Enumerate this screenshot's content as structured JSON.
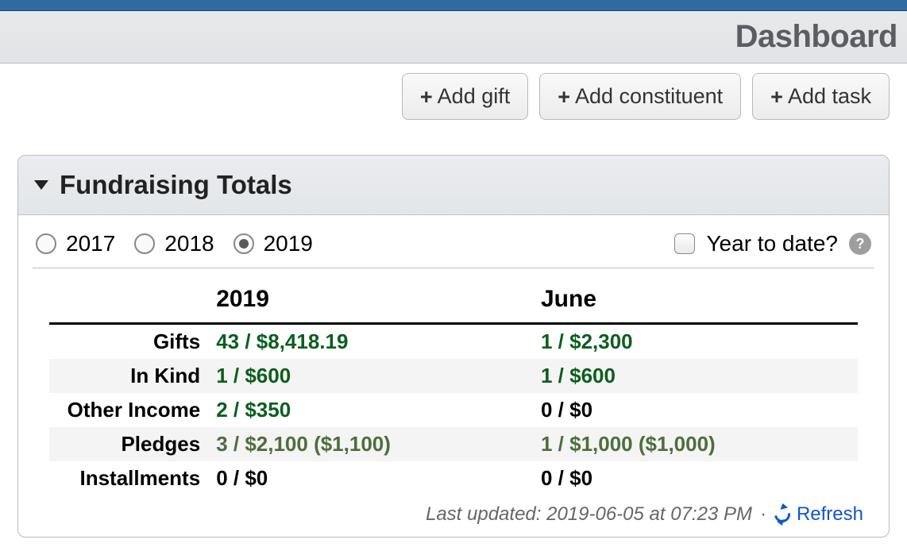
{
  "header": {
    "title": "Dashboard"
  },
  "actions": {
    "add_gift": "Add gift",
    "add_constituent": "Add constituent",
    "add_task": "Add task"
  },
  "panel": {
    "title": "Fundraising Totals",
    "years": [
      {
        "label": "2017",
        "selected": false
      },
      {
        "label": "2018",
        "selected": false
      },
      {
        "label": "2019",
        "selected": true
      }
    ],
    "ytd_label": "Year to date?",
    "ytd_checked": false,
    "columns": {
      "year": "2019",
      "period": "June"
    },
    "rows": [
      {
        "label": "Gifts",
        "year": "43 / $8,418.19",
        "year_style": "green",
        "period": "1 / $2,300",
        "period_style": "green",
        "striped": false
      },
      {
        "label": "In Kind",
        "year": "1 / $600",
        "year_style": "green",
        "period": "1 / $600",
        "period_style": "green",
        "striped": true
      },
      {
        "label": "Other Income",
        "year": "2 / $350",
        "year_style": "green",
        "period": "0 / $0",
        "period_style": "plain",
        "striped": false
      },
      {
        "label": "Pledges",
        "year": "3 / $2,100 ($1,100)",
        "year_style": "olive",
        "period": "1 / $1,000 ($1,000)",
        "period_style": "olive",
        "striped": true
      },
      {
        "label": "Installments",
        "year": "0 / $0",
        "year_style": "plain",
        "period": "0 / $0",
        "period_style": "plain",
        "striped": false
      }
    ],
    "footer": {
      "updated": "Last updated: 2019-06-05 at 07:23 PM",
      "refresh": "Refresh"
    }
  }
}
